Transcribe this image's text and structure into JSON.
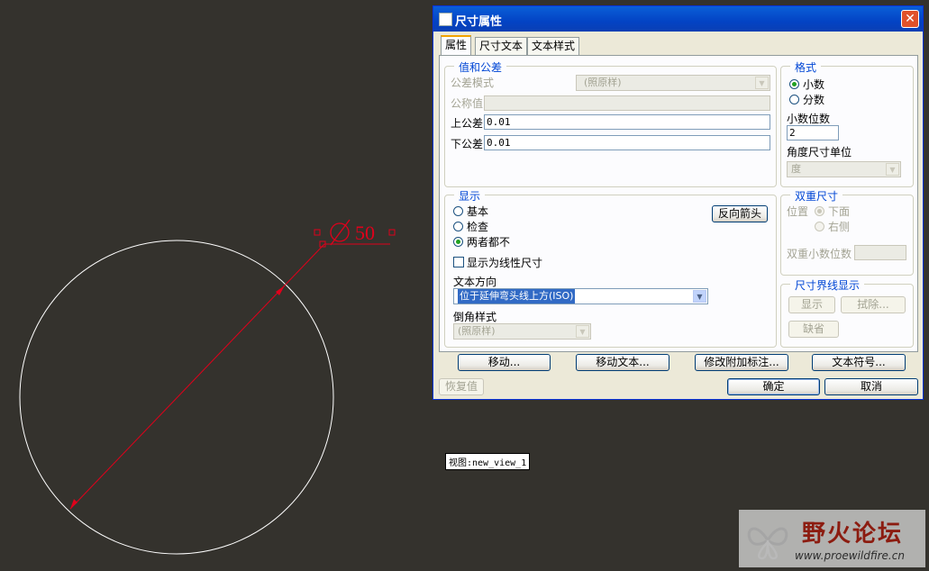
{
  "drawing": {
    "dimension_value": "50",
    "diameter_symbol": "⌀",
    "view_label": "视图:new_view_1",
    "line_color": "#ffffff",
    "dimension_color": "#e0001b"
  },
  "dialog": {
    "title": "尺寸属性",
    "close_glyph": "✕",
    "tabs": [
      {
        "label": "属性",
        "active": true
      },
      {
        "label": "尺寸文本",
        "active": false
      },
      {
        "label": "文本样式",
        "active": false
      }
    ],
    "value_tolerance": {
      "title": "值和公差",
      "tolerance_mode_label": "公差模式",
      "tolerance_mode_value": "(照原样)",
      "nominal_label": "公称值",
      "nominal_value": "",
      "upper_tol_label": "上公差",
      "upper_tol_value": "0.01",
      "lower_tol_label": "下公差",
      "lower_tol_value": "0.01"
    },
    "format": {
      "title": "格式",
      "decimal_label": "小数",
      "fraction_label": "分数",
      "selected": "decimal",
      "decimal_places_label": "小数位数",
      "decimal_places_value": "2",
      "angle_unit_label": "角度尺寸单位",
      "angle_unit_value": "度"
    },
    "display": {
      "title": "显示",
      "options": [
        "基本",
        "检查",
        "两者都不"
      ],
      "selected_index": 2,
      "reverse_arrow_label": "反向箭头",
      "linear_checkbox_label": "显示为线性尺寸",
      "linear_checked": false,
      "text_direction_label": "文本方向",
      "text_direction_value": "位于延伸弯头线上方(ISO)",
      "chamfer_label": "倒角样式",
      "chamfer_value": "(照原样)"
    },
    "dual_dim": {
      "title": "双重尺寸",
      "position_label": "位置",
      "below_label": "下面",
      "right_label": "右侧",
      "dual_decimals_label": "双重小数位数",
      "dual_decimals_value": ""
    },
    "witness_line": {
      "title": "尺寸界线显示",
      "show_label": "显示",
      "erase_label": "拭除...",
      "default_label": "缺省"
    },
    "bottom_buttons": {
      "move": "移动...",
      "move_text": "移动文本...",
      "modify_note": "修改附加标注...",
      "text_symbol": "文本符号...",
      "restore": "恢复值",
      "ok": "确定",
      "cancel": "取消"
    }
  },
  "watermark": {
    "title": "野火论坛",
    "url": "www.proewildfire.cn"
  }
}
